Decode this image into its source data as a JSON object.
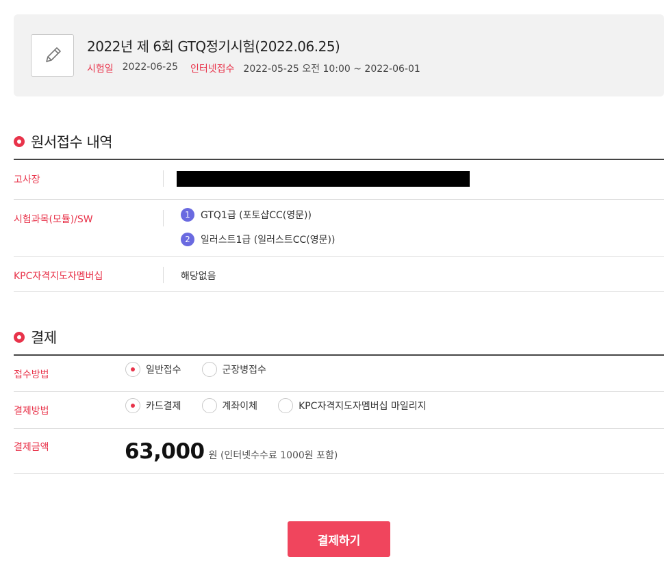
{
  "exam": {
    "title": "2022년 제 6회 GTQ정기시험(2022.06.25)",
    "date_label": "시험일",
    "date_value": "2022-06-25",
    "reg_label": "인터넷접수",
    "reg_value": "2022-05-25 오전 10:00 ~ 2022-06-01",
    "icon": "pencil-icon"
  },
  "application": {
    "section_title": "원서접수 내역",
    "venue_label": "고사장",
    "subject_label": "시험과목(모듈)/SW",
    "subjects": [
      {
        "num": "1",
        "name": "GTQ1급 (포토샵CC(영문))"
      },
      {
        "num": "2",
        "name": "일러스트1급 (일러스트CC(영문))"
      }
    ],
    "membership_label": "KPC자격지도자멤버십",
    "membership_value": "해당없음"
  },
  "payment": {
    "section_title": "결제",
    "receipt_label": "접수방법",
    "receipt_options": [
      {
        "label": "일반접수",
        "selected": true
      },
      {
        "label": "군장병접수",
        "selected": false
      }
    ],
    "method_label": "결제방법",
    "method_options": [
      {
        "label": "카드결제",
        "selected": true
      },
      {
        "label": "계좌이체",
        "selected": false
      },
      {
        "label": "KPC자격지도자멤버십 마일리지",
        "selected": false
      }
    ],
    "amount_label": "결제금액",
    "amount_value": "63,000",
    "amount_unit": "원 (인터넷수수료 1000원 포함)",
    "submit_label": "결제하기"
  },
  "colors": {
    "accent": "#e8334a",
    "badge": "#6a6ae0",
    "button": "#f0455d"
  }
}
